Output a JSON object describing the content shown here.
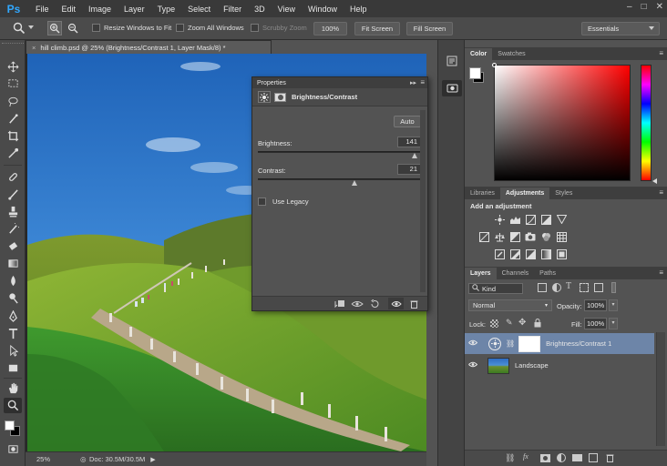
{
  "app": {
    "logo": "Ps"
  },
  "menu": [
    "File",
    "Edit",
    "Image",
    "Layer",
    "Type",
    "Select",
    "Filter",
    "3D",
    "View",
    "Window",
    "Help"
  ],
  "window_controls": {
    "minimize": "–",
    "maximize": "□",
    "close": "✕"
  },
  "options": {
    "resize_windows": "Resize Windows to Fit",
    "zoom_all": "Zoom All Windows",
    "scrubby_zoom": "Scrubby Zoom",
    "zoom_100": "100%",
    "fit_screen": "Fit Screen",
    "fill_screen": "Fill Screen",
    "workspace": "Essentials"
  },
  "document": {
    "tab_close": "×",
    "tab_title": "hill climb.psd @ 25% (Brightness/Contrast 1, Layer Mask/8) *",
    "zoom": "25%",
    "doc_info": "Doc: 30.5M/30.5M"
  },
  "properties": {
    "panel_title": "Properties",
    "adjustment_name": "Brightness/Contrast",
    "auto_label": "Auto",
    "brightness_label": "Brightness:",
    "brightness_value": "141",
    "contrast_label": "Contrast:",
    "contrast_value": "21",
    "use_legacy_label": "Use Legacy",
    "brightness_fraction": 0.97,
    "contrast_fraction": 0.6
  },
  "color_panel": {
    "tabs": [
      "Color",
      "Swatches"
    ],
    "foreground": "#ffffff",
    "background": "#000000",
    "hue_base": "#ff0000"
  },
  "adjustments_panel": {
    "tabs": [
      "Libraries",
      "Adjustments",
      "Styles"
    ],
    "heading": "Add an adjustment"
  },
  "layers_panel": {
    "tabs": [
      "Layers",
      "Channels",
      "Paths"
    ],
    "kind_filter": "Kind",
    "blend_mode": "Normal",
    "opacity_label": "Opacity:",
    "opacity_value": "100%",
    "lock_label": "Lock:",
    "fill_label": "Fill:",
    "fill_value": "100%",
    "layers": [
      {
        "name": "Brightness/Contrast 1",
        "selected": true
      },
      {
        "name": "Landscape",
        "selected": false
      }
    ]
  }
}
